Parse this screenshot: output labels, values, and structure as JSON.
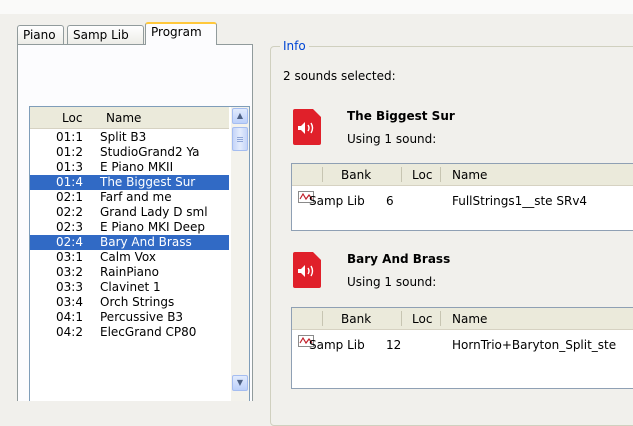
{
  "tabs": [
    {
      "label": "Piano",
      "active": false
    },
    {
      "label": "Samp Lib",
      "active": false
    },
    {
      "label": "Program",
      "active": true
    }
  ],
  "list": {
    "columns": {
      "loc": "Loc",
      "name": "Name"
    },
    "rows": [
      {
        "loc": "01:1",
        "name": "Split B3",
        "selected": false
      },
      {
        "loc": "01:2",
        "name": "StudioGrand2 Ya",
        "selected": false
      },
      {
        "loc": "01:3",
        "name": "E Piano MKII",
        "selected": false
      },
      {
        "loc": "01:4",
        "name": "The Biggest Sur",
        "selected": true
      },
      {
        "loc": "02:1",
        "name": "Farf and me",
        "selected": false
      },
      {
        "loc": "02:2",
        "name": "Grand Lady D sml",
        "selected": false
      },
      {
        "loc": "02:3",
        "name": "E Piano MKI Deep",
        "selected": false
      },
      {
        "loc": "02:4",
        "name": "Bary And Brass",
        "selected": true
      },
      {
        "loc": "03:1",
        "name": "Calm Vox",
        "selected": false
      },
      {
        "loc": "03:2",
        "name": "RainPiano",
        "selected": false
      },
      {
        "loc": "03:3",
        "name": "Clavinet 1",
        "selected": false
      },
      {
        "loc": "03:4",
        "name": "Orch Strings",
        "selected": false
      },
      {
        "loc": "04:1",
        "name": "Percussive B3",
        "selected": false
      },
      {
        "loc": "04:2",
        "name": "ElecGrand CP80",
        "selected": false
      }
    ]
  },
  "info": {
    "group_label": "Info",
    "selected_text": "2 sounds selected:",
    "sounds": [
      {
        "title": "The Biggest Sur",
        "using": "Using 1 sound:",
        "table": {
          "headers": {
            "bank": "Bank",
            "loc": "Loc",
            "name": "Name"
          },
          "row": {
            "bank": "Samp Lib",
            "loc": "6",
            "name": "FullStrings1__ste SRv4"
          }
        }
      },
      {
        "title": "Bary And Brass",
        "using": "Using 1 sound:",
        "table": {
          "headers": {
            "bank": "Bank",
            "loc": "Loc",
            "name": "Name"
          },
          "row": {
            "bank": "Samp Lib",
            "loc": "12",
            "name": "HornTrio+Baryton_Split_ste"
          }
        }
      }
    ]
  },
  "colors": {
    "selection": "#316ac5",
    "tab_highlight": "#ffc83c",
    "group_label": "#0046d5",
    "sound_icon": "#e0202a"
  },
  "icons": [
    "speaker-icon",
    "sample-waveform-icon",
    "scroll-up-icon",
    "scroll-down-icon"
  ]
}
